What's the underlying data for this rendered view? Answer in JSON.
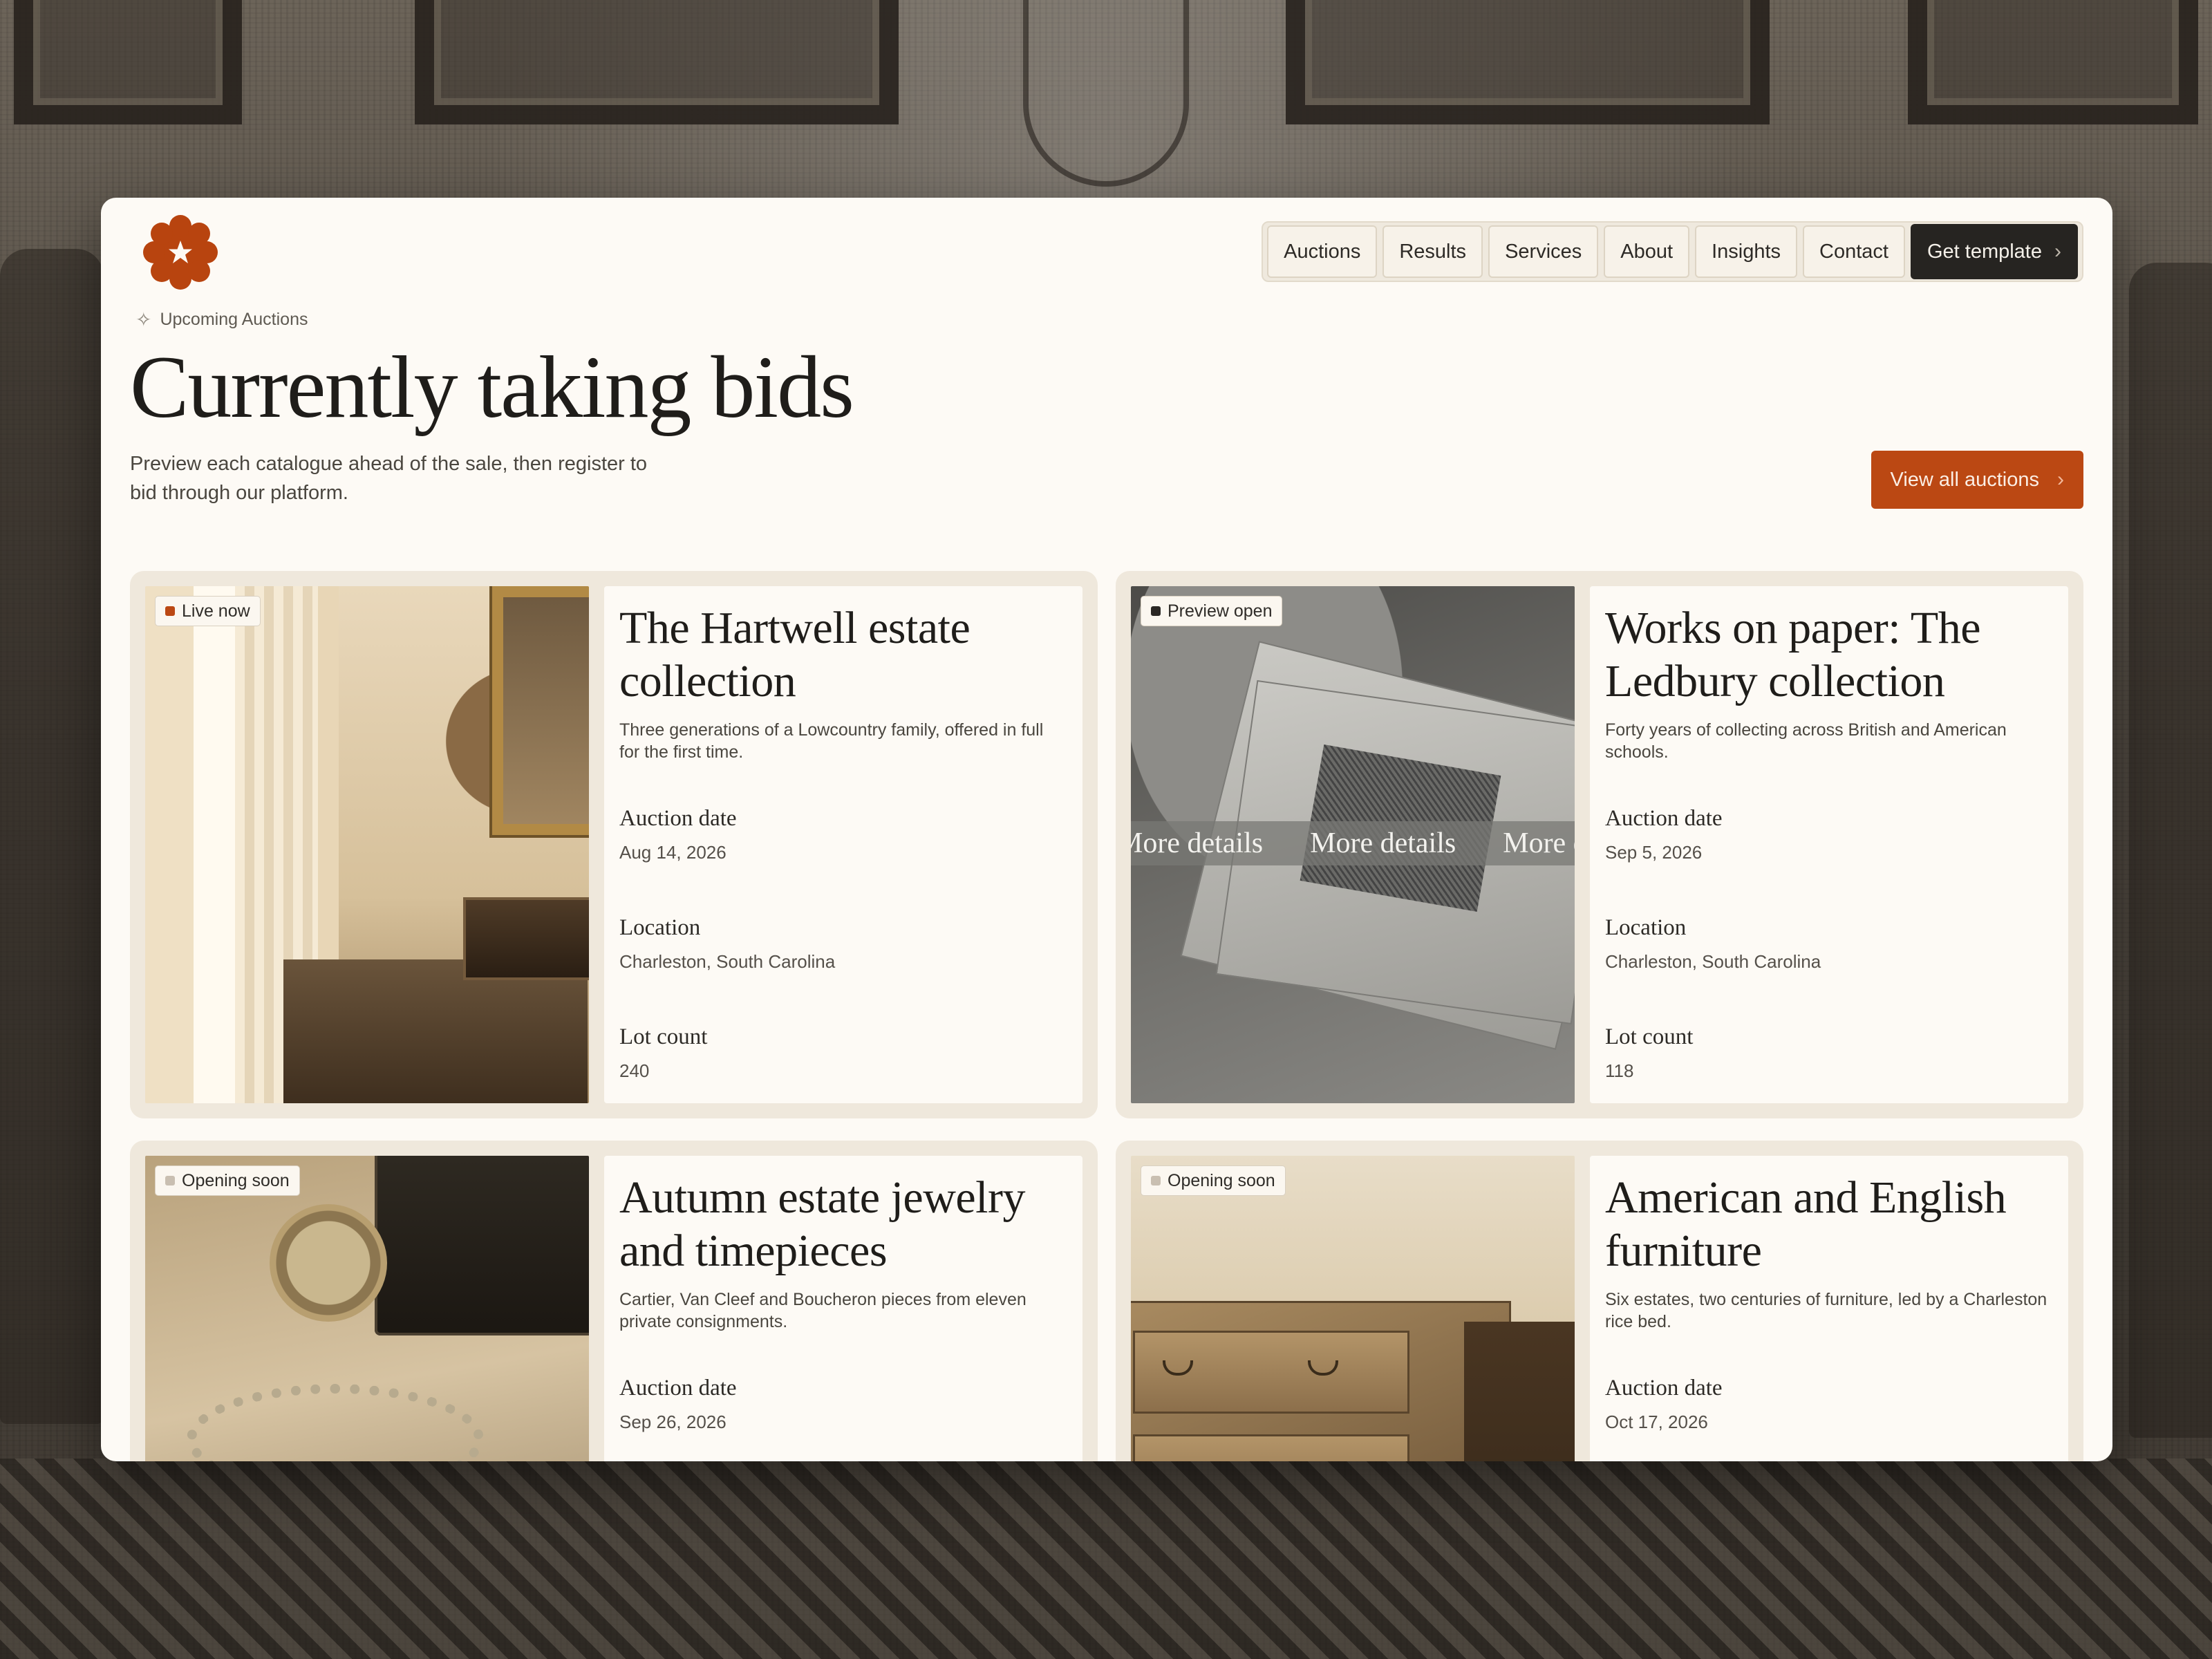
{
  "nav": {
    "items": [
      "Auctions",
      "Results",
      "Services",
      "About",
      "Insights",
      "Contact"
    ],
    "cta_label": "Get template"
  },
  "hero": {
    "eyebrow": "Upcoming Auctions",
    "title": "Currently taking bids",
    "intro": "Preview each catalogue ahead of the sale, then register to bid through our platform.",
    "view_all_label": "View all auctions"
  },
  "labels": {
    "auction_date": "Auction date",
    "location": "Location",
    "lot_count": "Lot count"
  },
  "cards": [
    {
      "badge": "Live now",
      "badge_color": "#bb4813",
      "title": "The Hartwell estate collection",
      "desc": "Three generations of a Lowcountry family, offered in full for the first time.",
      "auction_date": "Aug 14, 2026",
      "location": "Charleston, South Carolina",
      "lot_count": "240"
    },
    {
      "badge": "Preview open",
      "badge_color": "#2a2724",
      "title": "Works on paper: The Ledbury collection",
      "desc": "Forty years of collecting across British and American schools.",
      "auction_date": "Sep 5, 2026",
      "location": "Charleston, South Carolina",
      "lot_count": "118",
      "overlay_text": "More details"
    },
    {
      "badge": "Opening soon",
      "badge_color": "#c9bfb1",
      "title": "Autumn estate jewelry and timepieces",
      "desc": "Cartier, Van Cleef and Boucheron pieces from eleven private consignments.",
      "auction_date": "Sep 26, 2026"
    },
    {
      "badge": "Opening soon",
      "badge_color": "#c9bfb1",
      "title": "American and English furniture",
      "desc": "Six estates, two centuries of furniture, led by a Charleston rice bed.",
      "auction_date": "Oct 17, 2026"
    }
  ],
  "colors": {
    "accent": "#bb4813",
    "dark": "#262421",
    "surface": "#fdfaf5",
    "card_bg": "#efe8dc"
  }
}
